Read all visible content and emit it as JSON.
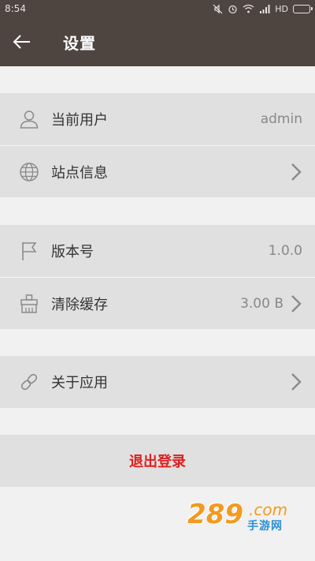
{
  "status_bar": {
    "time": "8:54",
    "network": "HD"
  },
  "app_bar": {
    "title": "设置",
    "back_icon": "arrow-left-icon"
  },
  "groups": [
    {
      "rows": [
        {
          "icon": "user-icon",
          "label": "当前用户",
          "value": "admin",
          "chevron": false
        },
        {
          "icon": "globe-icon",
          "label": "站点信息",
          "value": "",
          "chevron": true
        }
      ]
    },
    {
      "rows": [
        {
          "icon": "flag-icon",
          "label": "版本号",
          "value": "1.0.0",
          "chevron": false
        },
        {
          "icon": "broom-icon",
          "label": "清除缓存",
          "value": "3.00 B",
          "chevron": true
        }
      ]
    },
    {
      "rows": [
        {
          "icon": "link-icon",
          "label": "关于应用",
          "value": "",
          "chevron": true
        }
      ]
    }
  ],
  "logout": {
    "label": "退出登录",
    "color": "#e02020"
  },
  "watermark": {
    "number": "289",
    "suffix": ".com",
    "text": "手游网"
  },
  "colors": {
    "header": "#4e4440",
    "row_bg": "#e0e0e0",
    "page_bg": "#f1f1f1"
  }
}
